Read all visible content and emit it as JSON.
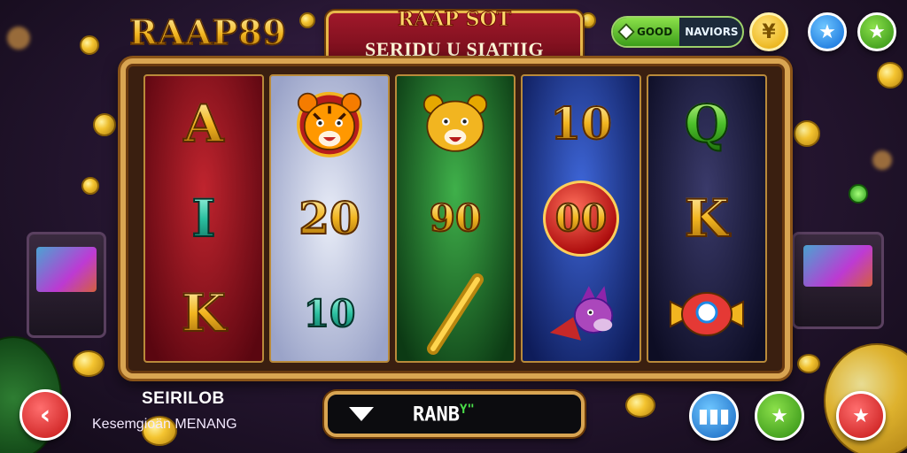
{
  "header": {
    "logo_text": "RAAP89",
    "banner_title": "RAAP SOT",
    "banner_subtitle": "SERIDU U SIATIIG MENANG"
  },
  "top_right": {
    "pill_left_label": "GOOD",
    "pill_right_label": "NAVIORS",
    "button_1_icon": "yen-icon",
    "button_2_icon": "star-icon",
    "button_3_icon": "leaf-star-icon"
  },
  "reels": [
    {
      "theme": "red",
      "symbols": [
        "A",
        "I",
        "K"
      ]
    },
    {
      "theme": "silver",
      "symbols": [
        "tiger",
        "20",
        "10"
      ]
    },
    {
      "theme": "green",
      "symbols": [
        "lion",
        "90",
        "torch"
      ]
    },
    {
      "theme": "blue",
      "symbols": [
        "10",
        "00",
        "wolf"
      ]
    },
    {
      "theme": "purple",
      "symbols": [
        "Q",
        "K",
        "candy"
      ]
    }
  ],
  "bottom": {
    "label_title": "SEIRILOB",
    "label_subtitle": "Kesemgioän MENANG",
    "spin_text": "RANB",
    "spin_suffix": "Y\"",
    "back_icon": "chevron-left-icon",
    "menu_icon": "bars-icon",
    "green_icon": "star-icon",
    "red_icon": "star-icon"
  },
  "colors": {
    "accent_gold": "#d9a552",
    "banner_red": "#a0182a",
    "back_button": "#e53935",
    "menu_button": "#1e88e5",
    "green_button": "#43a047",
    "red_button": "#e53935"
  }
}
